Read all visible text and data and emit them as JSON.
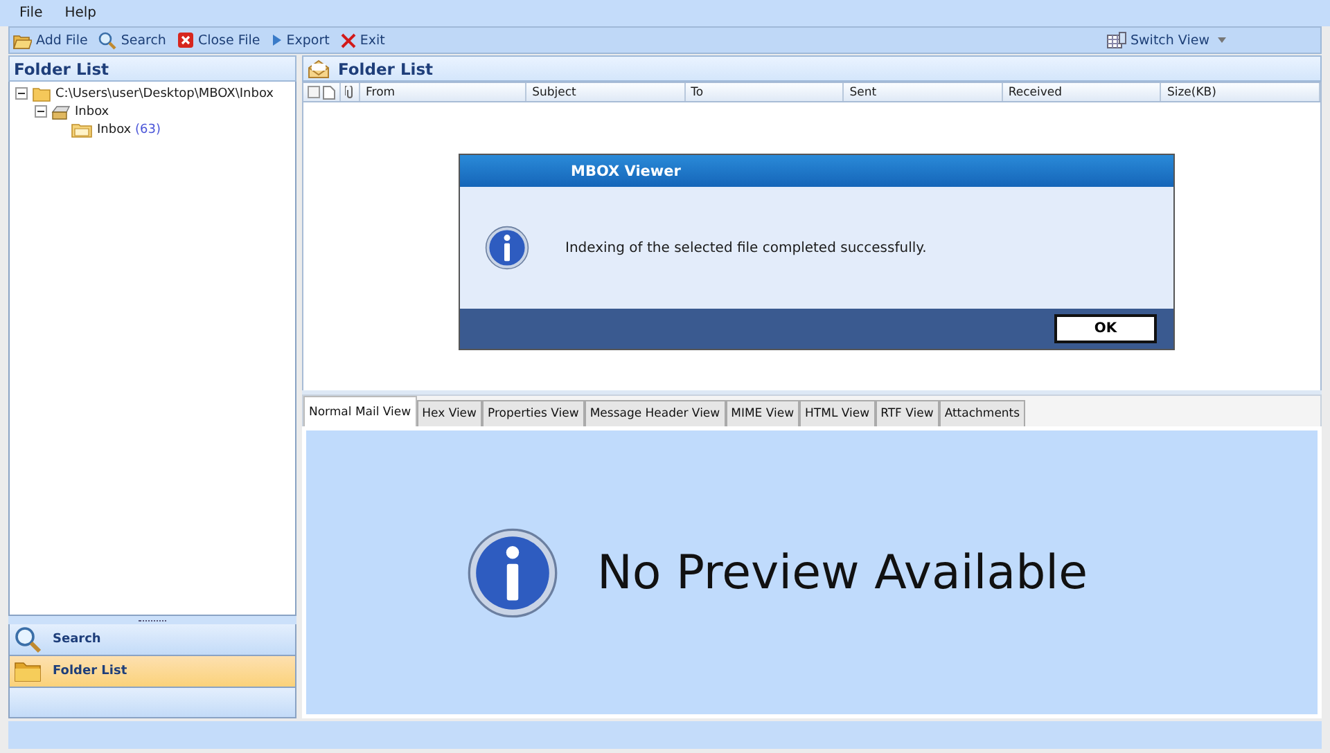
{
  "menu": [
    "File",
    "Help"
  ],
  "toolbar": [
    {
      "kind": "add",
      "label": "Add File"
    },
    {
      "kind": "search",
      "label": "Search"
    },
    {
      "kind": "close",
      "label": "Close File"
    },
    {
      "kind": "export",
      "label": "Export"
    },
    {
      "kind": "exit",
      "label": "Exit"
    }
  ],
  "switch_view": {
    "label": "Switch View"
  },
  "left_panel": {
    "title": "Folder List",
    "tree": [
      {
        "label": "C:\\Users\\user\\Desktop\\MBOX\\Inbox",
        "expanded": true,
        "kind": "folder",
        "children": [
          {
            "label": "Inbox",
            "expanded": true,
            "kind": "store",
            "children": [
              {
                "label": "Inbox",
                "count": "(63)",
                "kind": "mail"
              }
            ]
          }
        ]
      }
    ],
    "nav": [
      {
        "kind": "search",
        "label": "Search",
        "selected": false
      },
      {
        "kind": "folder",
        "label": "Folder List",
        "selected": true
      }
    ]
  },
  "right_panel": {
    "title": "Folder List",
    "columns": [
      "From",
      "Subject",
      "To",
      "Sent",
      "Received",
      "Size(KB)"
    ]
  },
  "dialog": {
    "title": "MBOX Viewer",
    "message": "Indexing of the selected file completed successfully.",
    "button": "OK"
  },
  "tabs": [
    {
      "label": "Normal Mail View",
      "selected": true
    },
    {
      "label": "Hex View",
      "selected": false
    },
    {
      "label": "Properties View",
      "selected": false
    },
    {
      "label": "Message Header View",
      "selected": false
    },
    {
      "label": "MIME View",
      "selected": false
    },
    {
      "label": "HTML View",
      "selected": false
    },
    {
      "label": "RTF View",
      "selected": false
    },
    {
      "label": "Attachments",
      "selected": false
    }
  ],
  "preview": {
    "message": "No Preview Available"
  }
}
